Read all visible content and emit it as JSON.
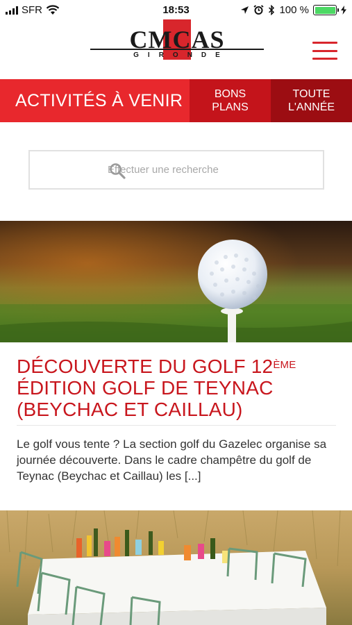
{
  "status_bar": {
    "carrier": "SFR",
    "time": "18:53",
    "battery_percent": "100 %",
    "battery_level": 1.0,
    "icons": [
      "signal-icon",
      "wifi-icon",
      "location-icon",
      "alarm-icon",
      "bluetooth-icon",
      "battery-icon",
      "charging-icon"
    ]
  },
  "header": {
    "logo_text": "CMCAS",
    "logo_subtitle": "GIRONDE",
    "menu_icon": "hamburger-icon"
  },
  "nav": {
    "active_label": "ACTIVITÉS À VENIR",
    "bons_plans_label": "BONS PLANS",
    "toute_annee_label": "TOUTE L'ANNÉE"
  },
  "search": {
    "placeholder": "Effectuer une recherche",
    "icon": "search-icon"
  },
  "articles": [
    {
      "title_line1_main": "DÉCOUVERTE DU GOLF 12",
      "title_line1_sup": "ÈME",
      "title_rest": "ÉDITION GOLF DE TEYNAC (BEYCHAC ET CAILLAU)",
      "excerpt": "Le golf vous tente ? La section golf du Gazelec organise sa journée découverte. Dans le cadre champêtre du golf de Teynac (Beychac et Caillau) les [...]"
    }
  ],
  "colors": {
    "brand_red": "#e8282d",
    "nav_mid_red": "#c4141b",
    "nav_dark_red": "#9c0d12",
    "title_red": "#c8161d",
    "battery_green": "#4cd964"
  }
}
